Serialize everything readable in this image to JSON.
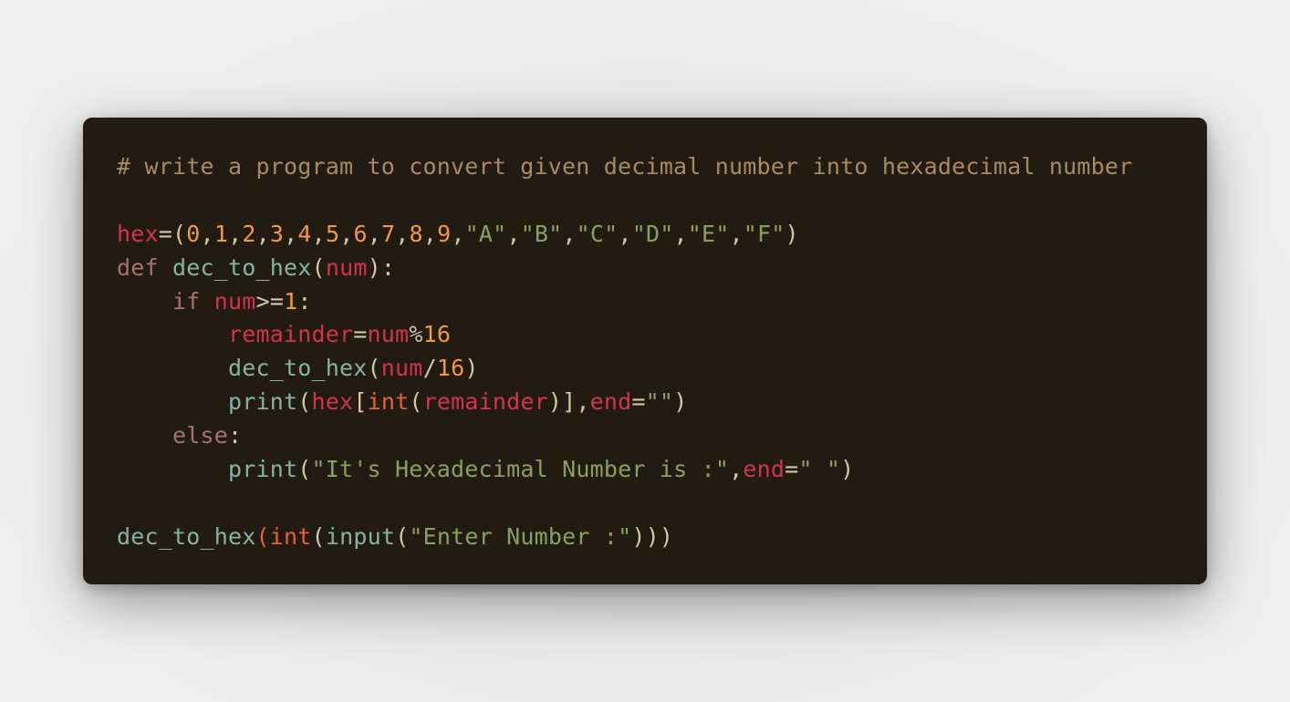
{
  "lines": [
    [
      {
        "t": "# write a program to convert given decimal number into hexadecimal number",
        "c": "comment"
      }
    ],
    [],
    [
      {
        "t": "hex",
        "c": "var"
      },
      {
        "t": "=(",
        "c": "punct"
      },
      {
        "t": "0",
        "c": "num"
      },
      {
        "t": ",",
        "c": "punct"
      },
      {
        "t": "1",
        "c": "num"
      },
      {
        "t": ",",
        "c": "punct"
      },
      {
        "t": "2",
        "c": "num"
      },
      {
        "t": ",",
        "c": "punct"
      },
      {
        "t": "3",
        "c": "num"
      },
      {
        "t": ",",
        "c": "punct"
      },
      {
        "t": "4",
        "c": "num"
      },
      {
        "t": ",",
        "c": "punct"
      },
      {
        "t": "5",
        "c": "num"
      },
      {
        "t": ",",
        "c": "punct"
      },
      {
        "t": "6",
        "c": "num"
      },
      {
        "t": ",",
        "c": "punct"
      },
      {
        "t": "7",
        "c": "num"
      },
      {
        "t": ",",
        "c": "punct"
      },
      {
        "t": "8",
        "c": "num"
      },
      {
        "t": ",",
        "c": "punct"
      },
      {
        "t": "9",
        "c": "num"
      },
      {
        "t": ",",
        "c": "punct"
      },
      {
        "t": "\"A\"",
        "c": "str"
      },
      {
        "t": ",",
        "c": "punct"
      },
      {
        "t": "\"B\"",
        "c": "str"
      },
      {
        "t": ",",
        "c": "punct"
      },
      {
        "t": "\"C\"",
        "c": "str"
      },
      {
        "t": ",",
        "c": "punct"
      },
      {
        "t": "\"D\"",
        "c": "str"
      },
      {
        "t": ",",
        "c": "punct"
      },
      {
        "t": "\"E\"",
        "c": "str"
      },
      {
        "t": ",",
        "c": "punct"
      },
      {
        "t": "\"F\"",
        "c": "str"
      },
      {
        "t": ")",
        "c": "punct"
      }
    ],
    [
      {
        "t": "def",
        "c": "kw"
      },
      {
        "t": " ",
        "c": "punct"
      },
      {
        "t": "dec_to_hex",
        "c": "fn"
      },
      {
        "t": "(",
        "c": "punct"
      },
      {
        "t": "num",
        "c": "var"
      },
      {
        "t": "):",
        "c": "punct"
      }
    ],
    [
      {
        "t": "    ",
        "c": "punct"
      },
      {
        "t": "if",
        "c": "kw"
      },
      {
        "t": " ",
        "c": "punct"
      },
      {
        "t": "num",
        "c": "var"
      },
      {
        "t": ">=",
        "c": "punct"
      },
      {
        "t": "1",
        "c": "num"
      },
      {
        "t": ":",
        "c": "punct"
      }
    ],
    [
      {
        "t": "        ",
        "c": "punct"
      },
      {
        "t": "remainder",
        "c": "var"
      },
      {
        "t": "=",
        "c": "punct"
      },
      {
        "t": "num",
        "c": "var"
      },
      {
        "t": "%",
        "c": "punct"
      },
      {
        "t": "16",
        "c": "num"
      }
    ],
    [
      {
        "t": "        ",
        "c": "punct"
      },
      {
        "t": "dec_to_hex",
        "c": "fn"
      },
      {
        "t": "(",
        "c": "punct"
      },
      {
        "t": "num",
        "c": "var"
      },
      {
        "t": "/",
        "c": "punct"
      },
      {
        "t": "16",
        "c": "num"
      },
      {
        "t": ")",
        "c": "punct"
      }
    ],
    [
      {
        "t": "        ",
        "c": "punct"
      },
      {
        "t": "print",
        "c": "fn"
      },
      {
        "t": "(",
        "c": "punct"
      },
      {
        "t": "hex",
        "c": "var"
      },
      {
        "t": "[",
        "c": "punct"
      },
      {
        "t": "int",
        "c": "builtin"
      },
      {
        "t": "(",
        "c": "punct"
      },
      {
        "t": "remainder",
        "c": "var"
      },
      {
        "t": ")],",
        "c": "punct"
      },
      {
        "t": "end",
        "c": "var"
      },
      {
        "t": "=",
        "c": "punct"
      },
      {
        "t": "\"\"",
        "c": "str"
      },
      {
        "t": ")",
        "c": "punct"
      }
    ],
    [
      {
        "t": "    ",
        "c": "punct"
      },
      {
        "t": "else",
        "c": "kw"
      },
      {
        "t": ":",
        "c": "punct"
      }
    ],
    [
      {
        "t": "        ",
        "c": "punct"
      },
      {
        "t": "print",
        "c": "fn"
      },
      {
        "t": "(",
        "c": "punct"
      },
      {
        "t": "\"It's Hexadecimal Number is :\"",
        "c": "str"
      },
      {
        "t": ",",
        "c": "punct"
      },
      {
        "t": "end",
        "c": "var"
      },
      {
        "t": "=",
        "c": "punct"
      },
      {
        "t": "\" \"",
        "c": "str"
      },
      {
        "t": ")",
        "c": "punct"
      }
    ],
    [],
    [
      {
        "t": "dec_to_hex",
        "c": "fn"
      },
      {
        "t": "(",
        "c": "builtin"
      },
      {
        "t": "int",
        "c": "builtin"
      },
      {
        "t": "(",
        "c": "punct"
      },
      {
        "t": "input",
        "c": "fn"
      },
      {
        "t": "(",
        "c": "punct"
      },
      {
        "t": "\"Enter Number :\"",
        "c": "str"
      },
      {
        "t": ")))",
        "c": "punct"
      }
    ]
  ],
  "colors": {
    "page_background": "#ebebeb",
    "code_background": "#221b12",
    "comment": "#a88a63",
    "variable": "#d2344f",
    "number": "#f29a3b",
    "string": "#8aa05e",
    "keyword": "#a47271",
    "function": "#87b3a5",
    "builtin": "#e66234",
    "punctuation": "#d3c7a9"
  }
}
